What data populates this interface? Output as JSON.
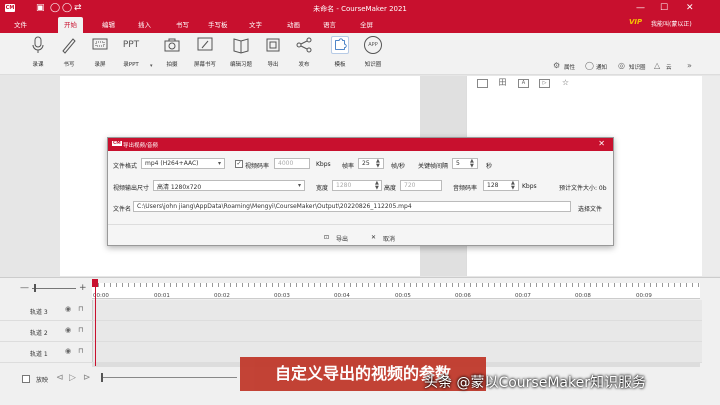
{
  "app": {
    "title": "未命名 - CourseMaker 2021",
    "logo": "CM",
    "quick_access": [
      "save-icon",
      "undo-icon",
      "redo-icon",
      "swap-icon"
    ],
    "window_controls": [
      "—",
      "☐",
      "✕"
    ],
    "vip": "VIP",
    "account": "我能叫(蒙以正)"
  },
  "menu": [
    "文件",
    "开始",
    "编辑",
    "插入",
    "书写",
    "手写板",
    "文字",
    "动画",
    "语言",
    "全屏"
  ],
  "ribbon": {
    "tools": [
      "录课",
      "书写",
      "录屏",
      "录PPT",
      "拍摄",
      "屏幕书写",
      "编辑习题",
      "导出",
      "发布",
      "模板",
      "知识圈"
    ],
    "ppt_text": "PPT",
    "app_text": "APP",
    "right": [
      "属性",
      "通知",
      "知识圈",
      "云"
    ],
    "right_icons": [
      "settings-icon",
      "chat-icon",
      "knowledge-icon",
      "cloud-icon"
    ],
    "expand": "»"
  },
  "props_panel": {
    "icons": [
      "layout-icon",
      "grid-icon",
      "text-icon",
      "media-icon",
      "star-icon"
    ],
    "glyphs": [
      "",
      "田",
      "A",
      "▷",
      "☆"
    ]
  },
  "dialog": {
    "logo": "CM",
    "title": "导出视频/音频",
    "close": "✕",
    "format_label": "文件格式",
    "format_value": "mp4 (H264+AAC)",
    "video_bitrate_label": "视频码率",
    "video_bitrate_checked": "✓",
    "video_bitrate_value": "4000",
    "kbps": "Kbps",
    "fps_label": "帧率",
    "fps_value": "25",
    "fps_unit": "帧/秒",
    "keyframe_label": "关键帧间隔",
    "keyframe_value": "5",
    "keyframe_unit": "秒",
    "size_label": "视频输出尺寸",
    "size_value": "高清 1280x720",
    "width_label": "宽度",
    "width_value": "1280",
    "height_label": "高度",
    "height_value": "720",
    "audio_label": "音频码率",
    "audio_value": "128",
    "audio_unit": "Kbps",
    "est_label": "预计文件大小: 0b",
    "filename_label": "文件名",
    "filename_value": "C:\\Users\\john jiang\\AppData\\Roaming\\Mengyi\\CourseMaker\\Output\\20220826_112205.mp4",
    "choose_file": "选择文件",
    "export_btn": "导出",
    "cancel_btn": "取消",
    "export_icon": "⊡",
    "cancel_icon": "✕"
  },
  "timeline": {
    "zoom_minus": "—",
    "zoom_plus": "+",
    "ticks": [
      "00:00",
      "00:01",
      "00:02",
      "00:03",
      "00:04",
      "00:05",
      "00:06",
      "00:07",
      "00:08",
      "00:09"
    ],
    "tracks": [
      "轨道 3",
      "轨道 2",
      "轨道 1"
    ],
    "eye_icon": "◉",
    "lock_icon": "⊓",
    "play_label": "放映"
  },
  "overlay": {
    "caption": "自定义导出的视频的参数",
    "watermark": "头条 @蒙以CourseMaker知识服务"
  }
}
